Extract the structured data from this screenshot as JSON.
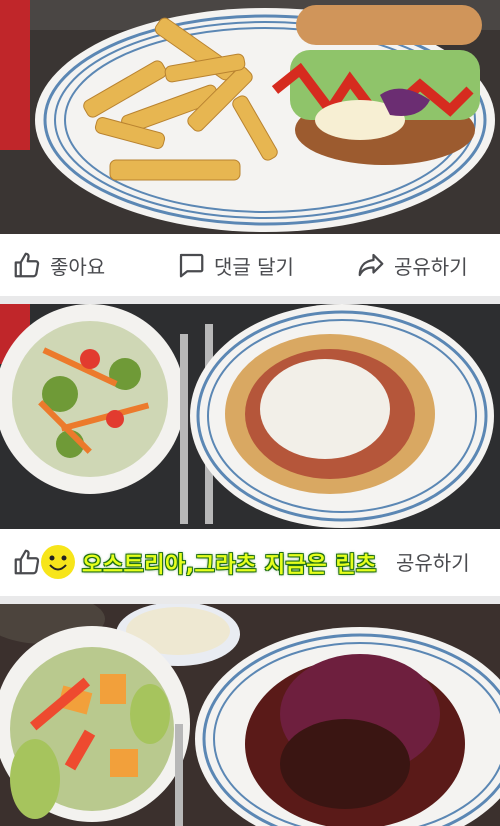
{
  "post1": {
    "actions": {
      "like": "좋아요",
      "comment": "댓글 달기",
      "share": "공유하기"
    }
  },
  "post2": {
    "caption": "오스트리아,그라츠 지금은 린츠",
    "actions": {
      "share": "공유하기"
    }
  },
  "colors": {
    "plate_stripe": "#5b87b4",
    "action_text": "#4a4b4f",
    "caption_fill": "#e6ff1c",
    "caption_outline": "#1d6e12"
  }
}
